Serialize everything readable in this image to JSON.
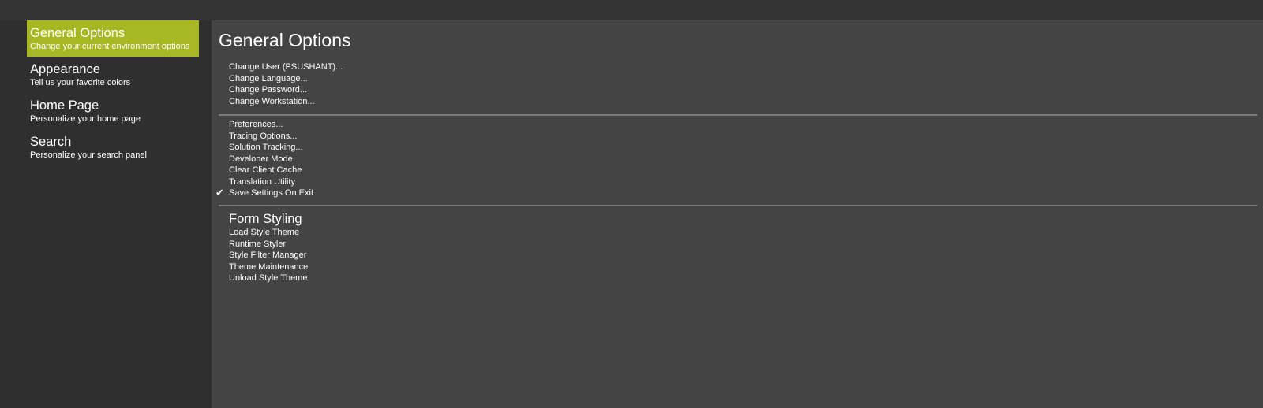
{
  "sidebar": {
    "items": [
      {
        "title": "General Options",
        "subtitle": "Change your current environment options",
        "selected": true
      },
      {
        "title": "Appearance",
        "subtitle": "Tell us your favorite colors",
        "selected": false
      },
      {
        "title": "Home Page",
        "subtitle": "Personalize your home page",
        "selected": false
      },
      {
        "title": "Search",
        "subtitle": "Personalize your search panel",
        "selected": false
      }
    ]
  },
  "main": {
    "title": "General Options",
    "account_items": [
      "Change User (PSUSHANT)...",
      "Change Language...",
      "Change Password...",
      "Change Workstation..."
    ],
    "tool_items": [
      {
        "label": "Preferences...",
        "checked": false
      },
      {
        "label": "Tracing Options...",
        "checked": false
      },
      {
        "label": "Solution Tracking...",
        "checked": false
      },
      {
        "label": "Developer Mode",
        "checked": false
      },
      {
        "label": "Clear Client Cache",
        "checked": false
      },
      {
        "label": "Translation Utility",
        "checked": false
      },
      {
        "label": "Save Settings On Exit",
        "checked": true
      }
    ],
    "form_styling": {
      "title": "Form Styling",
      "items": [
        "Load Style Theme",
        "Runtime Styler",
        "Style Filter Manager",
        "Theme Maintenance",
        "Unload Style Theme"
      ]
    }
  },
  "icons": {
    "check": "checkmark-icon"
  },
  "colors": {
    "accent": "#a8b824",
    "sidebar_bg": "#2f2f2f",
    "content_bg": "#444444",
    "divider": "#7a7a7a",
    "text": "#ffffff"
  }
}
